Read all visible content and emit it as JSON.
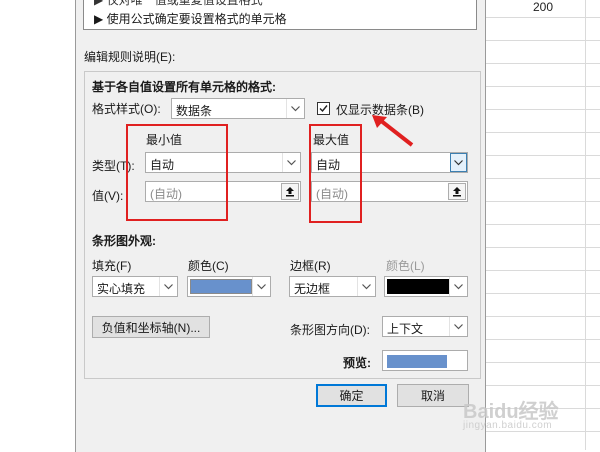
{
  "sheet": {
    "cell_value": "200"
  },
  "rule_list": {
    "item_partial": "▶ 仅对唯一值或重复值设置格式",
    "item_formula": "▶ 使用公式确定要设置格式的单元格"
  },
  "edit_rule": {
    "section_label": "编辑规则说明(E):",
    "header": "基于各自值设置所有单元格的格式:",
    "format_style_label": "格式样式(O):",
    "format_style_value": "数据条",
    "show_bar_only_label": "仅显示数据条(B)",
    "show_bar_only_checked": true,
    "min_header": "最小值",
    "max_header": "最大值",
    "type_label": "类型(T):",
    "value_label": "值(V):",
    "min_type": "自动",
    "max_type": "自动",
    "min_value_placeholder": "(自动)",
    "max_value_placeholder": "(自动)"
  },
  "bar_appearance": {
    "header": "条形图外观:",
    "fill_label": "填充(F)",
    "fill_value": "实心填充",
    "color_label": "颜色(C)",
    "fill_color": "#6891cc",
    "border_label": "边框(R)",
    "border_value": "无边框",
    "border_color_label": "颜色(L)",
    "border_color": "#000000",
    "negative_axis_button": "负值和坐标轴(N)...",
    "direction_label": "条形图方向(D):",
    "direction_value": "上下文",
    "preview_label": "预览:"
  },
  "footer": {
    "ok": "确定",
    "cancel": "取消"
  },
  "annotation": {
    "highlight_color": "#e02020"
  },
  "watermark": {
    "text": "Baidu经验",
    "url": "jingyan.baidu.com"
  }
}
